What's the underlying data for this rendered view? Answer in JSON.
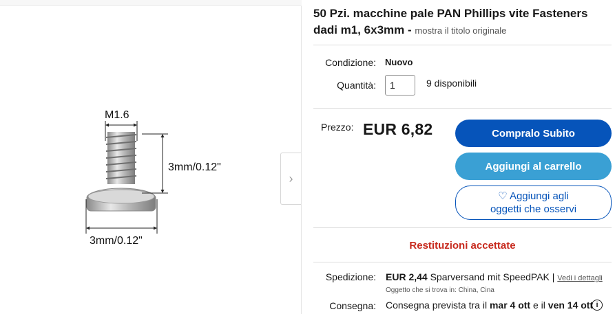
{
  "product": {
    "title": "50 Pzi. macchine pale PAN Phillips vite Fasteners dadi m1, 6x3mm -",
    "original_title_link": "mostra il titolo originale",
    "image_labels": {
      "thread": "M1.6",
      "length": "3mm/0.12\"",
      "head": "3mm/0.12\""
    }
  },
  "details": {
    "condition_label": "Condizione:",
    "condition_value": "Nuovo",
    "quantity_label": "Quantità:",
    "quantity_value": "1",
    "available": "9 disponibili"
  },
  "pricing": {
    "price_label": "Prezzo:",
    "price": "EUR 6,82"
  },
  "actions": {
    "buy_now": "Compralo Subito",
    "add_to_cart": "Aggiungi al carrello",
    "watch_line1": "♡ Aggiungi agli",
    "watch_line2": "oggetti che osservi"
  },
  "returns": "Restituzioni accettate",
  "shipping": {
    "label": "Spedizione:",
    "price": "EUR 2,44",
    "service": " Sparversand mit SpeedPAK | ",
    "details_link": "Vedi i dettagli",
    "location": "Oggetto che si trova in: China, Cina"
  },
  "delivery": {
    "label": "Consegna:",
    "prefix": "Consegna prevista tra il ",
    "date_from": "mar 4 ott",
    "middle": " e il ",
    "date_to": "ven 14 ott"
  },
  "icons": {
    "next": "chevron-right-icon",
    "info": "info-icon",
    "heart": "heart-icon"
  },
  "colors": {
    "buy_button": "#0654ba",
    "cart_button": "#3aa0d4",
    "returns_text": "#c7291d"
  }
}
